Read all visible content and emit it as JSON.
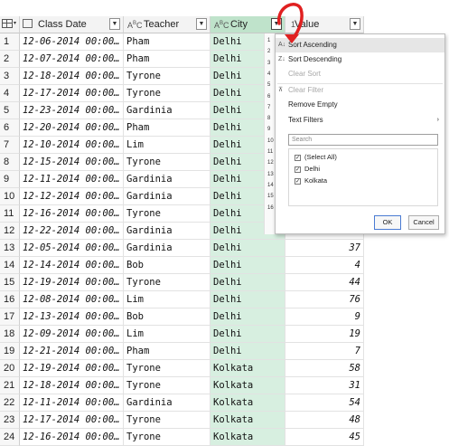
{
  "columns": {
    "class_date": {
      "label": "Class Date",
      "type_icon": "calendar-icon"
    },
    "teacher": {
      "label": "Teacher",
      "type_icon": "text-type-icon",
      "type_text": "A B C"
    },
    "city": {
      "label": "City",
      "type_icon": "text-type-icon",
      "type_text": "A B C"
    },
    "value": {
      "label": "Value",
      "type_text": "1"
    }
  },
  "rows": [
    {
      "n": "1",
      "date": "12-06-2014 00:00…",
      "teacher": "Pham",
      "city": "Delhi",
      "value": ""
    },
    {
      "n": "2",
      "date": "12-07-2014 00:00…",
      "teacher": "Pham",
      "city": "Delhi",
      "value": ""
    },
    {
      "n": "3",
      "date": "12-18-2014 00:00…",
      "teacher": "Tyrone",
      "city": "Delhi",
      "value": ""
    },
    {
      "n": "4",
      "date": "12-17-2014 00:00…",
      "teacher": "Tyrone",
      "city": "Delhi",
      "value": ""
    },
    {
      "n": "5",
      "date": "12-23-2014 00:00…",
      "teacher": "Gardinia",
      "city": "Delhi",
      "value": ""
    },
    {
      "n": "6",
      "date": "12-20-2014 00:00…",
      "teacher": "Pham",
      "city": "Delhi",
      "value": ""
    },
    {
      "n": "7",
      "date": "12-10-2014 00:00…",
      "teacher": "Lim",
      "city": "Delhi",
      "value": ""
    },
    {
      "n": "8",
      "date": "12-15-2014 00:00…",
      "teacher": "Tyrone",
      "city": "Delhi",
      "value": ""
    },
    {
      "n": "9",
      "date": "12-11-2014 00:00…",
      "teacher": "Gardinia",
      "city": "Delhi",
      "value": ""
    },
    {
      "n": "10",
      "date": "12-12-2014 00:00…",
      "teacher": "Gardinia",
      "city": "Delhi",
      "value": ""
    },
    {
      "n": "11",
      "date": "12-16-2014 00:00…",
      "teacher": "Tyrone",
      "city": "Delhi",
      "value": ""
    },
    {
      "n": "12",
      "date": "12-22-2014 00:00…",
      "teacher": "Gardinia",
      "city": "Delhi",
      "value": ""
    },
    {
      "n": "13",
      "date": "12-05-2014 00:00…",
      "teacher": "Gardinia",
      "city": "Delhi",
      "value": "37"
    },
    {
      "n": "14",
      "date": "12-14-2014 00:00…",
      "teacher": "Bob",
      "city": "Delhi",
      "value": "4"
    },
    {
      "n": "15",
      "date": "12-19-2014 00:00…",
      "teacher": "Tyrone",
      "city": "Delhi",
      "value": "44"
    },
    {
      "n": "16",
      "date": "12-08-2014 00:00…",
      "teacher": "Lim",
      "city": "Delhi",
      "value": "76"
    },
    {
      "n": "17",
      "date": "12-13-2014 00:00…",
      "teacher": "Bob",
      "city": "Delhi",
      "value": "9"
    },
    {
      "n": "18",
      "date": "12-09-2014 00:00…",
      "teacher": "Lim",
      "city": "Delhi",
      "value": "19"
    },
    {
      "n": "19",
      "date": "12-21-2014 00:00…",
      "teacher": "Pham",
      "city": "Delhi",
      "value": "7"
    },
    {
      "n": "20",
      "date": "12-19-2014 00:00…",
      "teacher": "Tyrone",
      "city": "Kolkata",
      "value": "58"
    },
    {
      "n": "21",
      "date": "12-18-2014 00:00…",
      "teacher": "Tyrone",
      "city": "Kolkata",
      "value": "31"
    },
    {
      "n": "22",
      "date": "12-11-2014 00:00…",
      "teacher": "Gardinia",
      "city": "Kolkata",
      "value": "54"
    },
    {
      "n": "23",
      "date": "12-17-2014 00:00…",
      "teacher": "Tyrone",
      "city": "Kolkata",
      "value": "48"
    },
    {
      "n": "24",
      "date": "12-16-2014 00:00…",
      "teacher": "Tyrone",
      "city": "Kolkata",
      "value": "45"
    }
  ],
  "peek_row_numbers": [
    "1",
    "2",
    "3",
    "4",
    "5",
    "6",
    "7",
    "8",
    "9",
    "10",
    "11",
    "12",
    "13",
    "14",
    "15",
    "16"
  ],
  "filter_menu": {
    "sort_ascending": "Sort Ascending",
    "sort_descending": "Sort Descending",
    "clear_sort": "Clear Sort",
    "clear_filter": "Clear Filter",
    "remove_empty": "Remove Empty",
    "text_filters": "Text Filters",
    "search_placeholder": "Search",
    "options": [
      {
        "label": "(Select All)",
        "checked": true
      },
      {
        "label": "Delhi",
        "checked": true
      },
      {
        "label": "Kolkata",
        "checked": true
      }
    ],
    "ok": "OK",
    "cancel": "Cancel"
  },
  "colors": {
    "city_column_bg": "#d7efe0",
    "arrow": "#e02020",
    "menu_highlight": "#e6e6e6"
  }
}
